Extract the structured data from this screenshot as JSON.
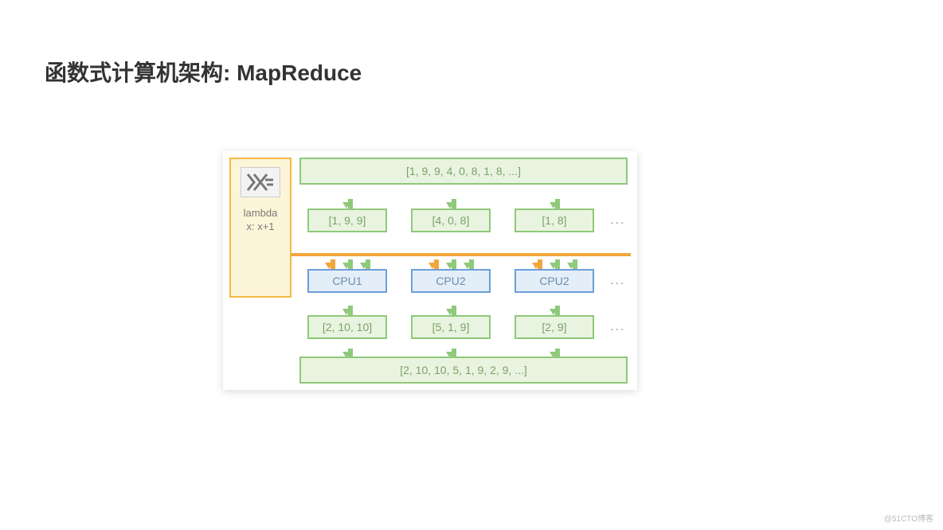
{
  "title": "函数式计算机架构: MapReduce",
  "watermark": "@51CTO博客",
  "lambda": {
    "logo": "λ=",
    "line1": "lambda",
    "line2": "x: x+1"
  },
  "input_full": "[1, 9, 9, 4, 0, 8, 1, 8, ...]",
  "input_chunks": [
    "[1, 9, 9]",
    "[4, 0, 8]",
    "[1, 8]"
  ],
  "cpus": [
    "CPU1",
    "CPU2",
    "CPU2"
  ],
  "output_chunks": [
    "[2, 10, 10]",
    "[5, 1, 9]",
    "[2, 9]"
  ],
  "output_full": "[2, 10, 10, 5, 1, 9, 2, 9, ...]",
  "ellipsis": "...",
  "chart_data": {
    "type": "diagram",
    "description": "MapReduce functional architecture: a lambda (x: x+1) is mapped over an input list split into chunks across CPUs, producing output chunks reduced back into one list.",
    "lambda": "x: x+1",
    "input": [
      1,
      9,
      9,
      4,
      0,
      8,
      1,
      8
    ],
    "input_chunks": [
      [
        1,
        9,
        9
      ],
      [
        4,
        0,
        8
      ],
      [
        1,
        8
      ]
    ],
    "processors": [
      "CPU1",
      "CPU2",
      "CPU2"
    ],
    "output_chunks": [
      [
        2,
        10,
        10
      ],
      [
        5,
        1,
        9
      ],
      [
        2,
        9
      ]
    ],
    "output": [
      2,
      10,
      10,
      5,
      1,
      9,
      2,
      9
    ]
  }
}
